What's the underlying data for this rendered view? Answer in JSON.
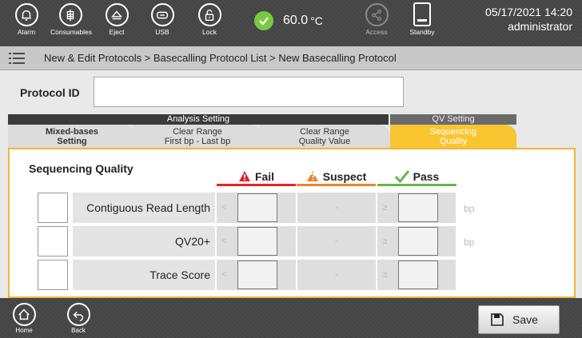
{
  "topbar": {
    "buttons": [
      {
        "label": "Alarm",
        "icon": "bell-icon"
      },
      {
        "label": "Consumables",
        "icon": "consumables-icon"
      },
      {
        "label": "Eject",
        "icon": "eject-icon"
      },
      {
        "label": "USB",
        "icon": "usb-icon"
      },
      {
        "label": "Lock",
        "icon": "lock-icon"
      }
    ],
    "temperature": {
      "value": "60.0",
      "unit": "°C",
      "status_color": "#7ac943"
    },
    "access_label": "Access",
    "standby_label": "Standby",
    "datetime": "05/17/2021 14:20",
    "user": "administrator"
  },
  "breadcrumb": "New & Edit Protocols > Basecalling Protocol List > New Basecalling Protocol",
  "protocol_id": {
    "label": "Protocol ID",
    "value": ""
  },
  "tab_groups": {
    "analysis": "Analysis Setting",
    "qv": "QV Setting"
  },
  "tabs": [
    {
      "label_1": "Mixed-bases",
      "label_2": "Setting"
    },
    {
      "label_1": "Clear Range",
      "label_2": "First bp - Last bp"
    },
    {
      "label_1": "Clear Range",
      "label_2": "Quality Value"
    },
    {
      "label_1": "Sequencing",
      "label_2": "Quality",
      "active": true
    }
  ],
  "panel": {
    "title": "Sequencing Quality",
    "columns": {
      "fail": {
        "label": "Fail",
        "color": "#e0262a"
      },
      "suspect": {
        "label": "Suspect",
        "color": "#e8852b"
      },
      "pass": {
        "label": "Pass",
        "color": "#6ab544"
      }
    },
    "rows": [
      {
        "label": "Contiguous Read Length",
        "fail_op": "<",
        "suspect": "-",
        "pass_op": "≥",
        "unit": "bp"
      },
      {
        "label": "QV20+",
        "fail_op": "<",
        "suspect": "-",
        "pass_op": "≥",
        "unit": "bp"
      },
      {
        "label": "Trace Score",
        "fail_op": "<",
        "suspect": "-",
        "pass_op": "≥",
        "unit": ""
      }
    ]
  },
  "bottombar": {
    "home_label": "Home",
    "back_label": "Back",
    "save_label": "Save"
  },
  "colors": {
    "accent": "#f9c531",
    "panel_border": "#f0b633"
  }
}
